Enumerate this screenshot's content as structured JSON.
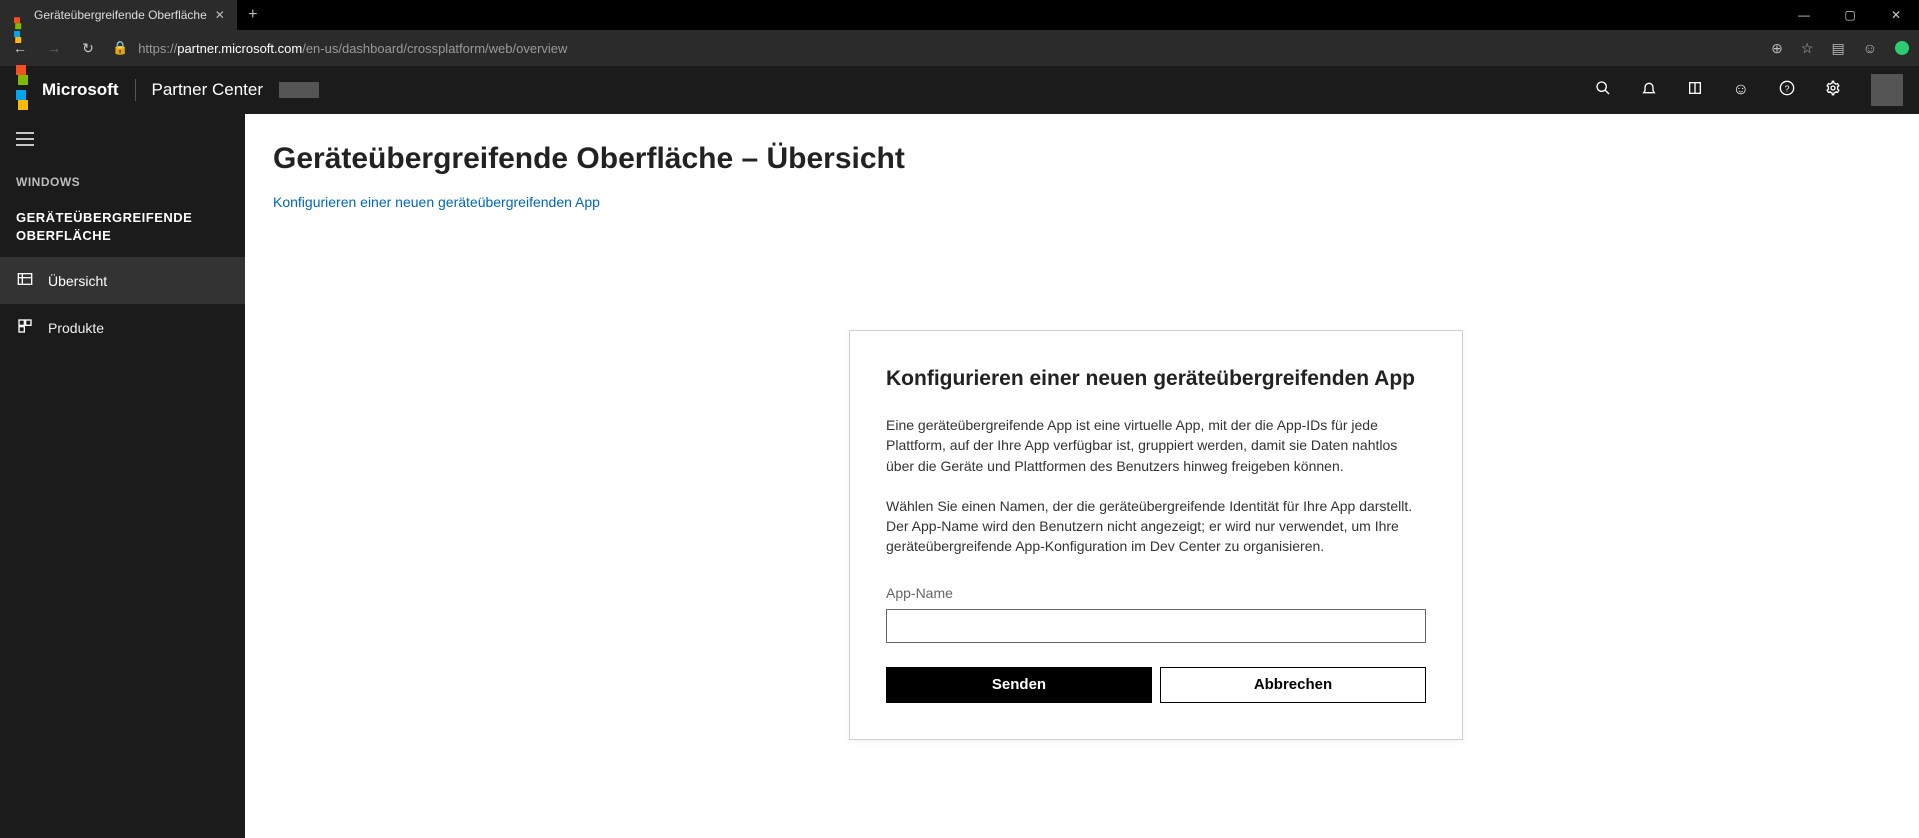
{
  "browser": {
    "tab_title": "Geräteübergreifende Oberfläche",
    "url_scheme": "https://",
    "url_host": "partner.microsoft.com",
    "url_path": "/en-us/dashboard/crossplatform/web/overview"
  },
  "header": {
    "brand": "Microsoft",
    "product": "Partner Center"
  },
  "sidebar": {
    "category": "WINDOWS",
    "section": "GERÄTEÜBERGREIFENDE OBERFLÄCHE",
    "items": [
      {
        "label": "Übersicht"
      },
      {
        "label": "Produkte"
      }
    ]
  },
  "page": {
    "title": "Geräteübergreifende Oberfläche – Übersicht",
    "link": "Konfigurieren einer neuen geräteübergreifenden App"
  },
  "dialog": {
    "title": "Konfigurieren einer neuen geräteübergreifenden App",
    "para1": "Eine geräteübergreifende App ist eine virtuelle App, mit der die App-IDs für jede Plattform, auf der Ihre App verfügbar ist, gruppiert werden, damit sie Daten nahtlos über die Geräte und Plattformen des Benutzers hinweg freigeben können.",
    "para2": "Wählen Sie einen Namen, der die geräteübergreifende Identität für Ihre App darstellt. Der App-Name wird den Benutzern nicht angezeigt; er wird nur verwendet, um Ihre geräteübergreifende App-Konfiguration im Dev Center zu organisieren.",
    "field_label": "App-Name",
    "submit": "Senden",
    "cancel": "Abbrechen"
  }
}
